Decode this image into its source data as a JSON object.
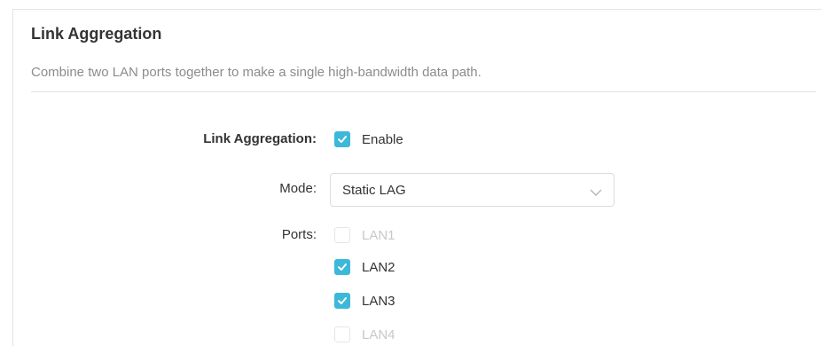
{
  "section": {
    "title": "Link Aggregation",
    "description": "Combine two LAN ports together to make a single high-bandwidth data path."
  },
  "form": {
    "link_aggregation": {
      "label": "Link Aggregation:",
      "checkbox_label": "Enable",
      "checked": true
    },
    "mode": {
      "label": "Mode:",
      "value": "Static LAG",
      "icon": "chevron-down-icon"
    },
    "ports": {
      "label": "Ports:",
      "items": [
        {
          "label": "LAN1",
          "checked": false,
          "disabled": true
        },
        {
          "label": "LAN2",
          "checked": true,
          "disabled": false
        },
        {
          "label": "LAN3",
          "checked": true,
          "disabled": false
        },
        {
          "label": "LAN4",
          "checked": false,
          "disabled": true
        }
      ]
    }
  },
  "colors": {
    "accent": "#3cb8da",
    "text": "#333333",
    "muted": "#8c8c8c",
    "disabled": "#c8c8c8"
  }
}
